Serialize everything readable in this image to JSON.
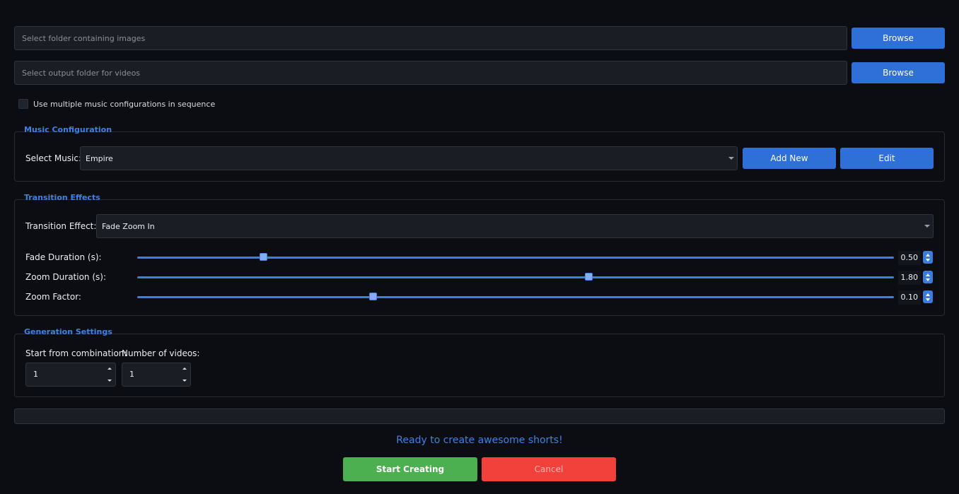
{
  "folders": {
    "images_placeholder": "Select folder containing images",
    "output_placeholder": "Select output folder for videos",
    "browse_label": "Browse"
  },
  "multi_music": {
    "label": "Use multiple music configurations in sequence",
    "checked": false
  },
  "music": {
    "title": "Music Configuration",
    "select_label": "Select Music:",
    "selected": "Empire",
    "add_label": "Add New",
    "edit_label": "Edit"
  },
  "transitions": {
    "title": "Transition Effects",
    "effect_label": "Transition Effect:",
    "effect_selected": "Fade Zoom In",
    "fade": {
      "label": "Fade Duration (s):",
      "value": "0.50",
      "fraction": 0.167
    },
    "zoom_duration": {
      "label": "Zoom Duration (s):",
      "value": "1.80",
      "fraction": 0.597
    },
    "zoom_factor": {
      "label": "Zoom Factor:",
      "value": "0.10",
      "fraction": 0.312
    }
  },
  "generation": {
    "title": "Generation Settings",
    "start_label": "Start from combination:",
    "start_value": "1",
    "count_label": "Number of videos:",
    "count_value": "1"
  },
  "progress": {
    "value": 0
  },
  "status_text": "Ready to create awesome shorts!",
  "actions": {
    "start_label": "Start Creating",
    "cancel_label": "Cancel"
  },
  "colors": {
    "accent": "#3b82e6",
    "start": "#4caf50",
    "cancel": "#f2413a",
    "background": "#0b0d12"
  }
}
